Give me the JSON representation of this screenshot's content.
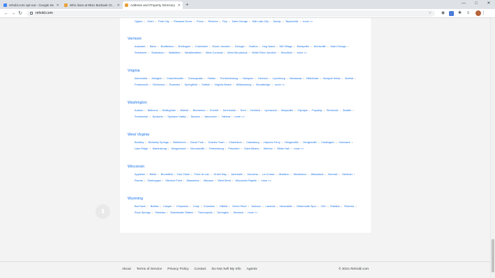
{
  "browser": {
    "tabs": [
      {
        "title": "rehold.com opt-out - Google Se",
        "favicon_color": "#4285f4",
        "active": false
      },
      {
        "title": "Who lives at 8511 Burbank Ct, Y",
        "favicon_color": "#e8a23a",
        "active": false
      },
      {
        "title": "Address and Property Directory",
        "favicon_color": "#e8a23a",
        "active": true
      }
    ],
    "new_tab_label": "+",
    "url": "rehold.com"
  },
  "states": [
    {
      "name": "",
      "cities": [
        "Ogden",
        "Orem",
        "Park City",
        "Pleasant Grove",
        "Provo",
        "Riverton",
        "Roy",
        "Saint George",
        "Salt Lake City",
        "Sandy",
        "Taylorsville",
        "more >>"
      ]
    },
    {
      "name": "Vermont",
      "cities": [
        "Adamant",
        "Barre",
        "Brattleboro",
        "Burlington",
        "Colchester",
        "Essex Junction",
        "Georgia",
        "Grafton",
        "Hog Island",
        "Mill Village",
        "Montpelier",
        "Morrisville",
        "Saint George",
        "Shelburne",
        "Starksboro",
        "Waitsfield",
        "Weathersfield",
        "West Cornwall",
        "West Woodstock",
        "White River Junction",
        "Woodford",
        "more >>"
      ]
    },
    {
      "name": "Virginia",
      "cities": [
        "Alexandria",
        "Arlington",
        "Charlottesville",
        "Chesapeake",
        "Fairfax",
        "Fredericksburg",
        "Hampton",
        "Herndon",
        "Lynchburg",
        "Manassas",
        "Midlothian",
        "Newport News",
        "Norfolk",
        "Portsmouth",
        "Richmond",
        "Roanoke",
        "Springfield",
        "Suffolk",
        "Virginia Beach",
        "Williamsburg",
        "Woodbridge",
        "more >>"
      ]
    },
    {
      "name": "Washington",
      "cities": [
        "Auburn",
        "Bellevue",
        "Bellingham",
        "Bothell",
        "Bremerton",
        "Everett",
        "Kennewick",
        "Kent",
        "Kirkland",
        "Lynnwood",
        "Marysville",
        "Olympia",
        "Puyallup",
        "Redmond",
        "Seattle",
        "Snohomish",
        "Spokane",
        "Spokane Valley",
        "Tacoma",
        "Vancouver",
        "Yakima",
        "more >>"
      ]
    },
    {
      "name": "West Virginia",
      "cities": [
        "Beckley",
        "Berkeley Springs",
        "Bethlehem",
        "Brush Fork",
        "Charles Town",
        "Charleston",
        "Clarksburg",
        "Harpers Ferry",
        "Hedgesville",
        "Hedgesville",
        "Huntington",
        "Hurricane",
        "Lake Ridge",
        "Martinsburg",
        "Morgantown",
        "Moundsville",
        "Parkersburg",
        "Princeton",
        "Saint Albans",
        "Weirton",
        "White Hall",
        "more >>"
      ]
    },
    {
      "name": "Wisconsin",
      "cities": [
        "Appleton",
        "Beloit",
        "Brookfield",
        "Eau Claire",
        "Fond du Lac",
        "Green Bay",
        "Janesville",
        "Kenosha",
        "La Crosse",
        "Madison",
        "Manitowoc",
        "Milwaukee",
        "Neenah",
        "Oshkosh",
        "Racine",
        "Sheboygan",
        "Stevens Point",
        "Waukesha",
        "Wausau",
        "West Bend",
        "Wisconsin Rapids",
        "more >>"
      ]
    },
    {
      "name": "Wyoming",
      "cities": [
        "Bar Nunn",
        "Buffalo",
        "Casper",
        "Cheyenne",
        "Cody",
        "Evanston",
        "Gillette",
        "Green River",
        "Jackson",
        "Laramie",
        "Newcastle",
        "Oldsmobile Spur",
        "Orin",
        "Rawlins",
        "Riverton",
        "Rock Springs",
        "Sheridan",
        "Sweetwater Station",
        "Thermopolis",
        "Torrington",
        "Worland",
        "more >>"
      ]
    }
  ],
  "scroll_top_icon": "arrow-up-icon",
  "footer": {
    "links": [
      "About",
      "Terms of Service",
      "Privacy Policy",
      "Contact",
      "Do Not Sell My Info",
      "Agents"
    ],
    "copyright": "© 2021 Rehold.com"
  }
}
